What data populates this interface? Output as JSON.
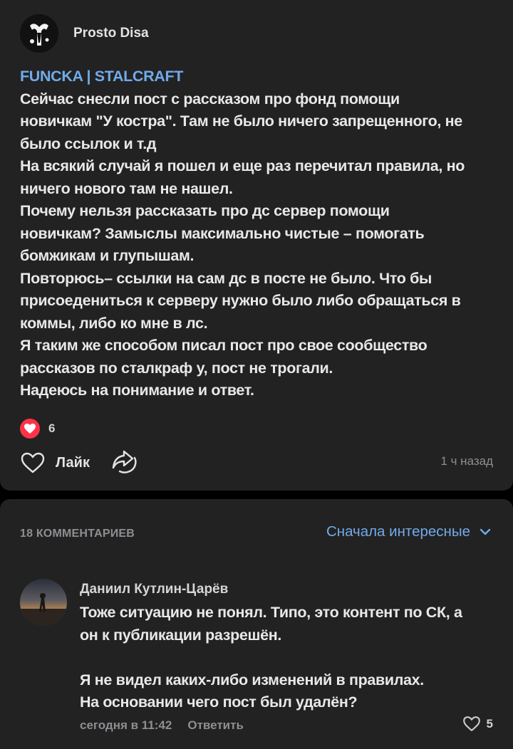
{
  "post": {
    "author": "Prosto Disa",
    "tag": "FUNCKA | STALCRAFT",
    "text_lines": [
      "Сейчас снесли пост с рассказом про фонд помощи",
      "новичкам \"У костра\". Там не было ничего запрещенного, не",
      "было ссылок и т.д",
      "На всякий случай я пошел и еще раз перечитал правила, но",
      "ничего нового там не нашел.",
      "Почему нельзя рассказать про дс сервер помощи",
      "новичкам? Замыслы максимально чистые – помогать",
      "бомжикам и глупышам.",
      "Повторюсь– ссылки на сам дс в посте не было.  Что бы",
      "присоедениться к серверу нужно было либо обращаться в",
      "коммы, либо ко мне в лс.",
      "Я таким же способом писал пост про свое сообщество",
      "рассказов по сталкраф у, пост не трогали.",
      "Надеюсь на понимание и ответ."
    ],
    "likes_count": "6",
    "like_label": "Лайк",
    "time": "1 ч назад"
  },
  "comments_section": {
    "count_label": "18 КОММЕНТАРИЕВ",
    "sort_label": "Сначала интересные",
    "comment": {
      "author": "Даниил Кутлин-Царёв",
      "text_lines": [
        "Тоже ситуацию не понял. Типо, это контент по СК, а",
        "он к публикации разрешён.",
        "",
        "Я не видел каких-либо изменений в правилах.",
        "На основании чего пост был удалён?"
      ],
      "time": "сегодня в 11:42",
      "reply_label": "Ответить",
      "likes": "5"
    }
  },
  "colors": {
    "background": "#000000",
    "card": "#222222",
    "accent": "#71aaeb",
    "like_red": "#ff3347",
    "secondary_text": "#8e8e93"
  },
  "icons": [
    "heart-icon",
    "share-icon",
    "chevron-down-icon"
  ]
}
